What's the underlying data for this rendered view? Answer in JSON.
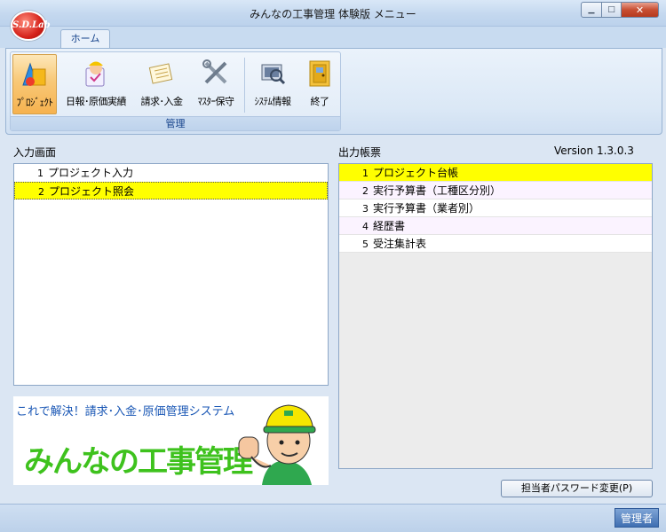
{
  "window": {
    "title": "みんなの工事管理 体験版 メニュー",
    "logo": "S.D.Lab",
    "min_icon": "minimize-icon",
    "max_icon": "maximize-icon",
    "close_icon": "close-icon"
  },
  "ribbon": {
    "tab": "ホーム",
    "group_label": "管理",
    "buttons": [
      {
        "label": "ﾌﾟﾛｼﾞｪｸﾄ",
        "icon": "project-shapes-icon",
        "selected": true
      },
      {
        "label": "日報･原価実績",
        "icon": "worker-report-icon",
        "selected": false
      },
      {
        "label": "請求･入金",
        "icon": "invoice-icon",
        "selected": false
      },
      {
        "label": "ﾏｽﾀｰ保守",
        "icon": "tools-icon",
        "selected": false
      },
      {
        "label": "ｼｽﾃﾑ情報",
        "icon": "system-info-icon",
        "selected": false
      },
      {
        "label": "終了",
        "icon": "exit-door-icon",
        "selected": false
      }
    ]
  },
  "input_panel": {
    "label": "入力画面",
    "items": [
      {
        "num": "1",
        "label": "プロジェクト入力"
      },
      {
        "num": "2",
        "label": "プロジェクト照会"
      }
    ],
    "selected_index": 1
  },
  "output_panel": {
    "label": "出力帳票",
    "version": "Version 1.3.0.3",
    "items": [
      {
        "num": "1",
        "label": "プロジェクト台帳"
      },
      {
        "num": "2",
        "label": "実行予算書（工種区分別）"
      },
      {
        "num": "3",
        "label": "実行予算書（業者別）"
      },
      {
        "num": "4",
        "label": "経歴書"
      },
      {
        "num": "5",
        "label": "受注集計表"
      }
    ],
    "selected_index": 0
  },
  "banner": {
    "tagline": "これで解決！請求･入金･原価管理システム",
    "product": "みんなの工事管理",
    "icon": "construction-worker-icon"
  },
  "password_button": "担当者パスワード変更(P)",
  "status": {
    "user": "管理者"
  },
  "colors": {
    "selection": "#ffff00",
    "banner_green": "#3ec21d",
    "banner_blue": "#1a57b5",
    "ribbon_selected": "#f8c877"
  }
}
